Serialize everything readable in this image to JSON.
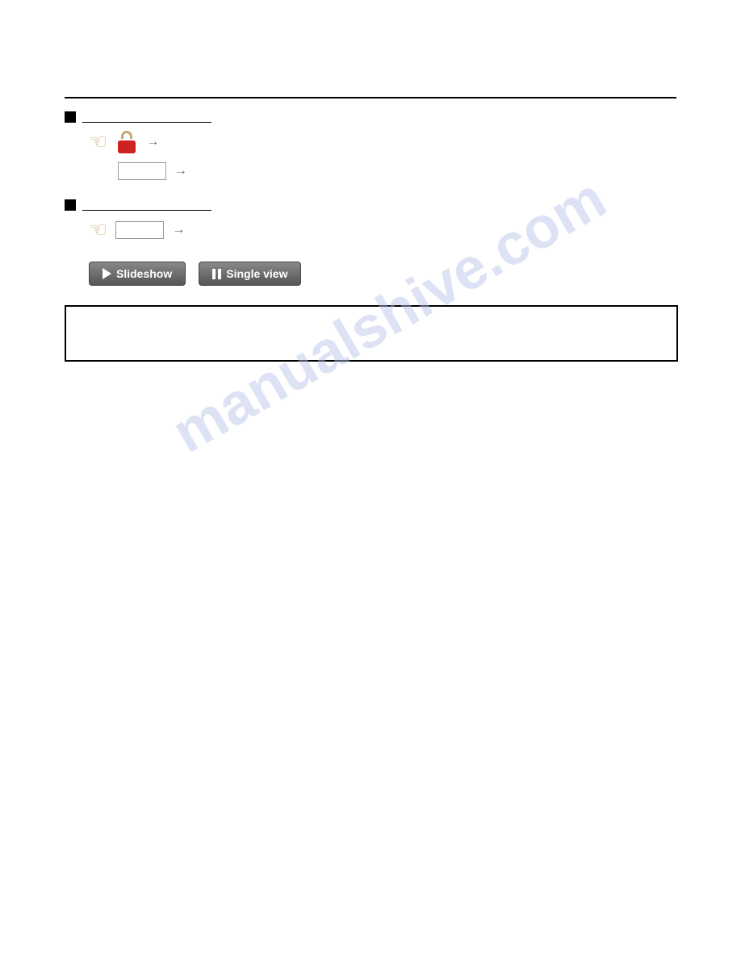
{
  "watermark": {
    "text": "manualshive.com"
  },
  "section1": {
    "label": ""
  },
  "section2": {
    "label": ""
  },
  "buttons": {
    "slideshow_label": "Slideshow",
    "single_view_label": "Single view"
  },
  "arrows": {
    "arrow1": "→",
    "arrow2": "→",
    "arrow3": "→"
  },
  "info_box": {
    "content": ""
  }
}
